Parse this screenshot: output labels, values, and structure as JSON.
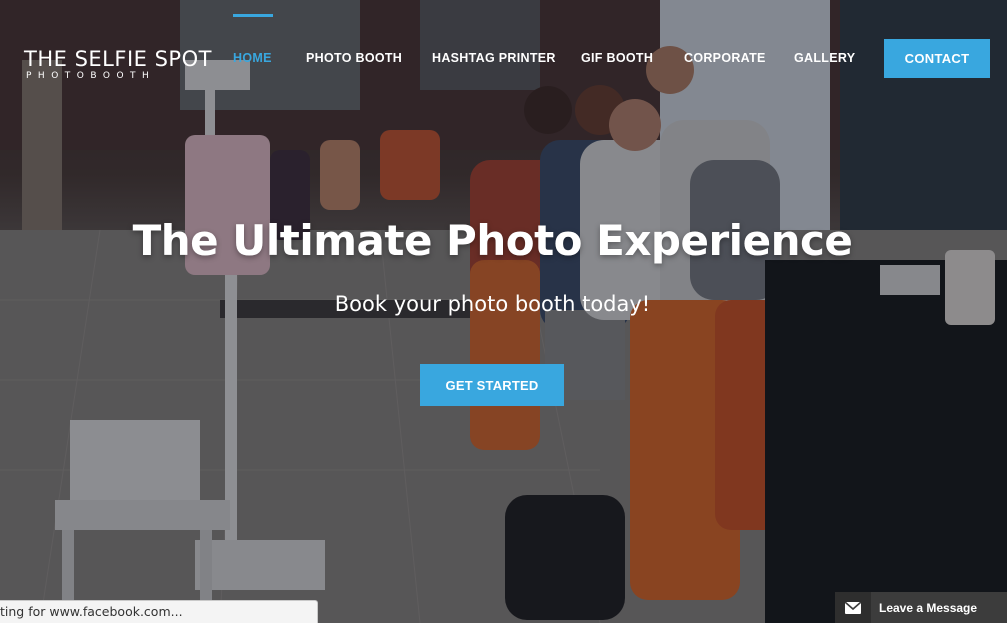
{
  "brand": {
    "logo_main": "THE SELFIE SPOT",
    "logo_sub": "PHOTOBOOTH"
  },
  "nav": {
    "items": [
      {
        "label": "HOME",
        "active": true
      },
      {
        "label": "PHOTO BOOTH",
        "active": false
      },
      {
        "label": "HASHTAG PRINTER",
        "active": false
      },
      {
        "label": "GIF BOOTH",
        "active": false
      },
      {
        "label": "CORPORATE",
        "active": false
      },
      {
        "label": "GALLERY",
        "active": false
      }
    ],
    "contact_label": "CONTACT"
  },
  "hero": {
    "headline": "The Ultimate Photo Experience",
    "subheadline": "Book your photo booth today!",
    "cta_label": "GET STARTED"
  },
  "status_bar": {
    "text": "ting for www.facebook.com..."
  },
  "chat_widget": {
    "label": "Leave a Message",
    "icon": "envelope-icon"
  },
  "colors": {
    "accent": "#39a7df",
    "overlay": "#14161e",
    "chat_bg": "#3c3c3c"
  }
}
